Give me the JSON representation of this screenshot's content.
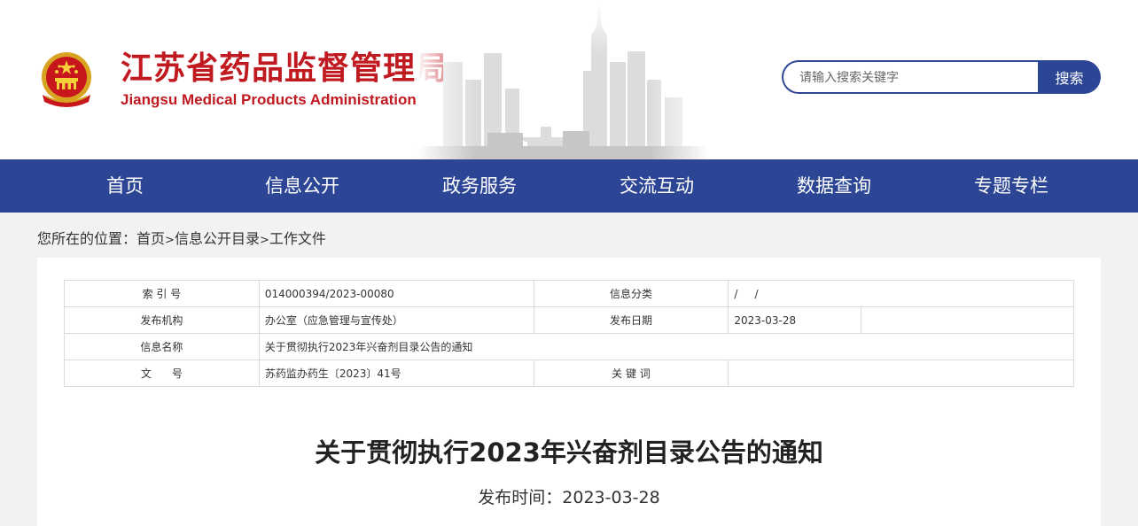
{
  "header": {
    "title_cn": "江苏省药品监督管理局",
    "title_en": "Jiangsu Medical Products Administration",
    "search_placeholder": "请输入搜索关键字",
    "search_button": "搜索"
  },
  "nav": [
    "首页",
    "信息公开",
    "政务服务",
    "交流互动",
    "数据查询",
    "专题专栏"
  ],
  "breadcrumb": {
    "prefix": "您所在的位置：",
    "items": [
      "首页",
      "信息公开目录",
      "工作文件"
    ],
    "sep": ">"
  },
  "meta": {
    "index_label": "索 引 号",
    "index_value": "014000394/2023-00080",
    "category_label": "信息分类",
    "category_value": "/     /",
    "org_label": "发布机构",
    "org_value": "办公室（应急管理与宣传处）",
    "date_label": "发布日期",
    "date_value": "2023-03-28",
    "name_label": "信息名称",
    "name_value": "关于贯彻执行2023年兴奋剂目录公告的通知",
    "docno_label": "文      号",
    "docno_value": "苏药监办药生〔2023〕41号",
    "keyword_label": "关 键 词",
    "keyword_value": ""
  },
  "article": {
    "title": "关于贯彻执行2023年兴奋剂目录公告的通知",
    "pub_date": "发布时间：2023-03-28"
  },
  "colors": {
    "brand_red": "#c01920",
    "nav_blue": "#2c4695"
  }
}
